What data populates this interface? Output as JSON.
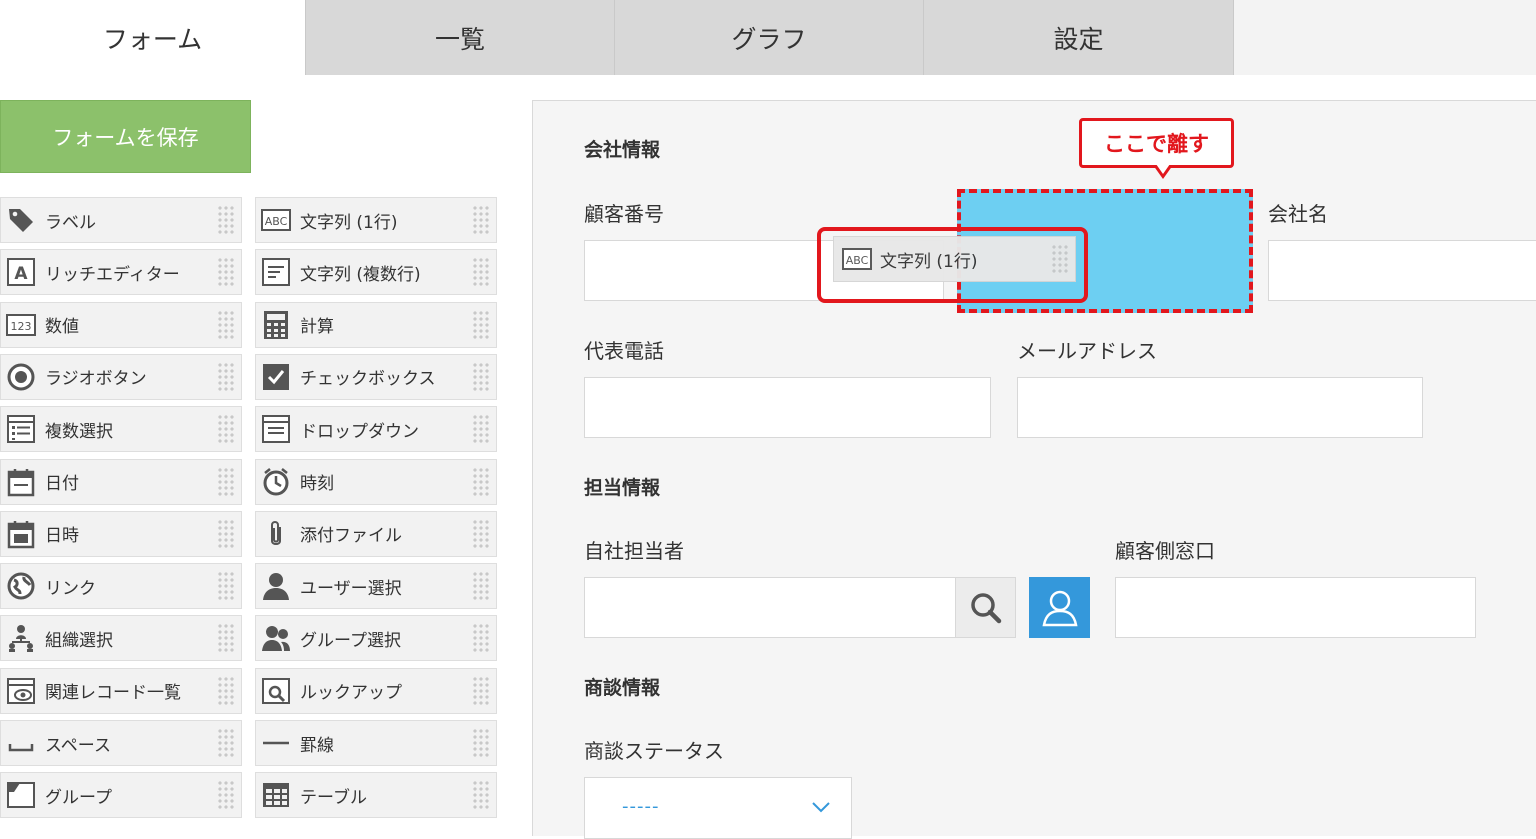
{
  "tabs": [
    {
      "label": "フォーム",
      "active": true
    },
    {
      "label": "一覧",
      "active": false
    },
    {
      "label": "グラフ",
      "active": false
    },
    {
      "label": "設定",
      "active": false
    }
  ],
  "save_button": "フォームを保存",
  "palette": [
    {
      "label": "ラベル",
      "icon": "tag-icon"
    },
    {
      "label": "文字列 (1行)",
      "icon": "abc-text-icon"
    },
    {
      "label": "リッチエディター",
      "icon": "rich-editor-icon"
    },
    {
      "label": "文字列 (複数行)",
      "icon": "multiline-text-icon"
    },
    {
      "label": "数値",
      "icon": "number-123-icon"
    },
    {
      "label": "計算",
      "icon": "calculator-icon"
    },
    {
      "label": "ラジオボタン",
      "icon": "radio-button-icon"
    },
    {
      "label": "チェックボックス",
      "icon": "checkbox-icon"
    },
    {
      "label": "複数選択",
      "icon": "multi-select-icon"
    },
    {
      "label": "ドロップダウン",
      "icon": "dropdown-icon"
    },
    {
      "label": "日付",
      "icon": "date-icon"
    },
    {
      "label": "時刻",
      "icon": "clock-icon"
    },
    {
      "label": "日時",
      "icon": "datetime-icon"
    },
    {
      "label": "添付ファイル",
      "icon": "paperclip-icon"
    },
    {
      "label": "リンク",
      "icon": "globe-link-icon"
    },
    {
      "label": "ユーザー選択",
      "icon": "user-icon"
    },
    {
      "label": "組織選択",
      "icon": "org-chart-icon"
    },
    {
      "label": "グループ選択",
      "icon": "group-icon"
    },
    {
      "label": "関連レコード一覧",
      "icon": "related-records-icon"
    },
    {
      "label": "ルックアップ",
      "icon": "lookup-icon"
    },
    {
      "label": "スペース",
      "icon": "space-icon"
    },
    {
      "label": "罫線",
      "icon": "line-icon"
    },
    {
      "label": "グループ",
      "icon": "group-frame-icon"
    },
    {
      "label": "テーブル",
      "icon": "table-icon"
    }
  ],
  "form": {
    "sections": [
      "会社情報",
      "担当情報",
      "商談情報"
    ],
    "fields": {
      "customer_number": "顧客番号",
      "company_name": "会社名",
      "phone": "代表電話",
      "email": "メールアドレス",
      "own_staff": "自社担当者",
      "customer_contact": "顧客側窓口",
      "deal_status": "商談ステータス"
    },
    "deal_status_value": "-----"
  },
  "drag": {
    "callout": "ここで離す",
    "item_label": "文字列 (1行)",
    "item_icon": "abc-text-icon"
  },
  "colors": {
    "save_green": "#8cc16b",
    "drop_blue": "#6dcff2",
    "highlight_red": "#e2171d",
    "user_button_blue": "#3498db"
  }
}
